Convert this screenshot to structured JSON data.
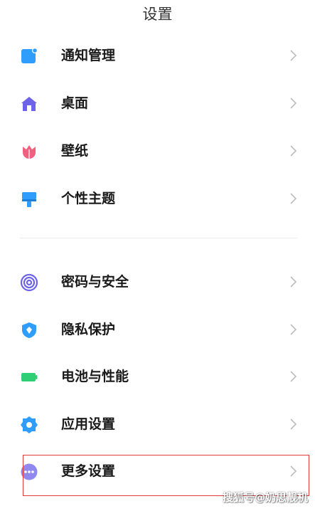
{
  "header": {
    "title": "设置"
  },
  "menu": {
    "items": [
      {
        "label": "通知管理",
        "icon": "notification-icon",
        "color": "#2e9dfb"
      },
      {
        "label": "桌面",
        "icon": "home-icon",
        "color": "#6c63e6"
      },
      {
        "label": "壁纸",
        "icon": "tulip-icon",
        "color": "#f0607f"
      },
      {
        "label": "个性主题",
        "icon": "paint-brush-icon",
        "color": "#2e9dfb"
      },
      {
        "label": "密码与安全",
        "icon": "fingerprint-icon",
        "color": "#6c63e6"
      },
      {
        "label": "隐私保护",
        "icon": "shield-icon",
        "color": "#2e9dfb"
      },
      {
        "label": "电池与性能",
        "icon": "battery-icon",
        "color": "#2ecf74"
      },
      {
        "label": "应用设置",
        "icon": "gear-icon",
        "color": "#2e9dfb"
      },
      {
        "label": "更多设置",
        "icon": "more-icon",
        "color": "#8f89ef"
      }
    ]
  },
  "highlight_color": "#e23a3a",
  "watermark": {
    "text": "搜狐号@奶思靓机"
  }
}
